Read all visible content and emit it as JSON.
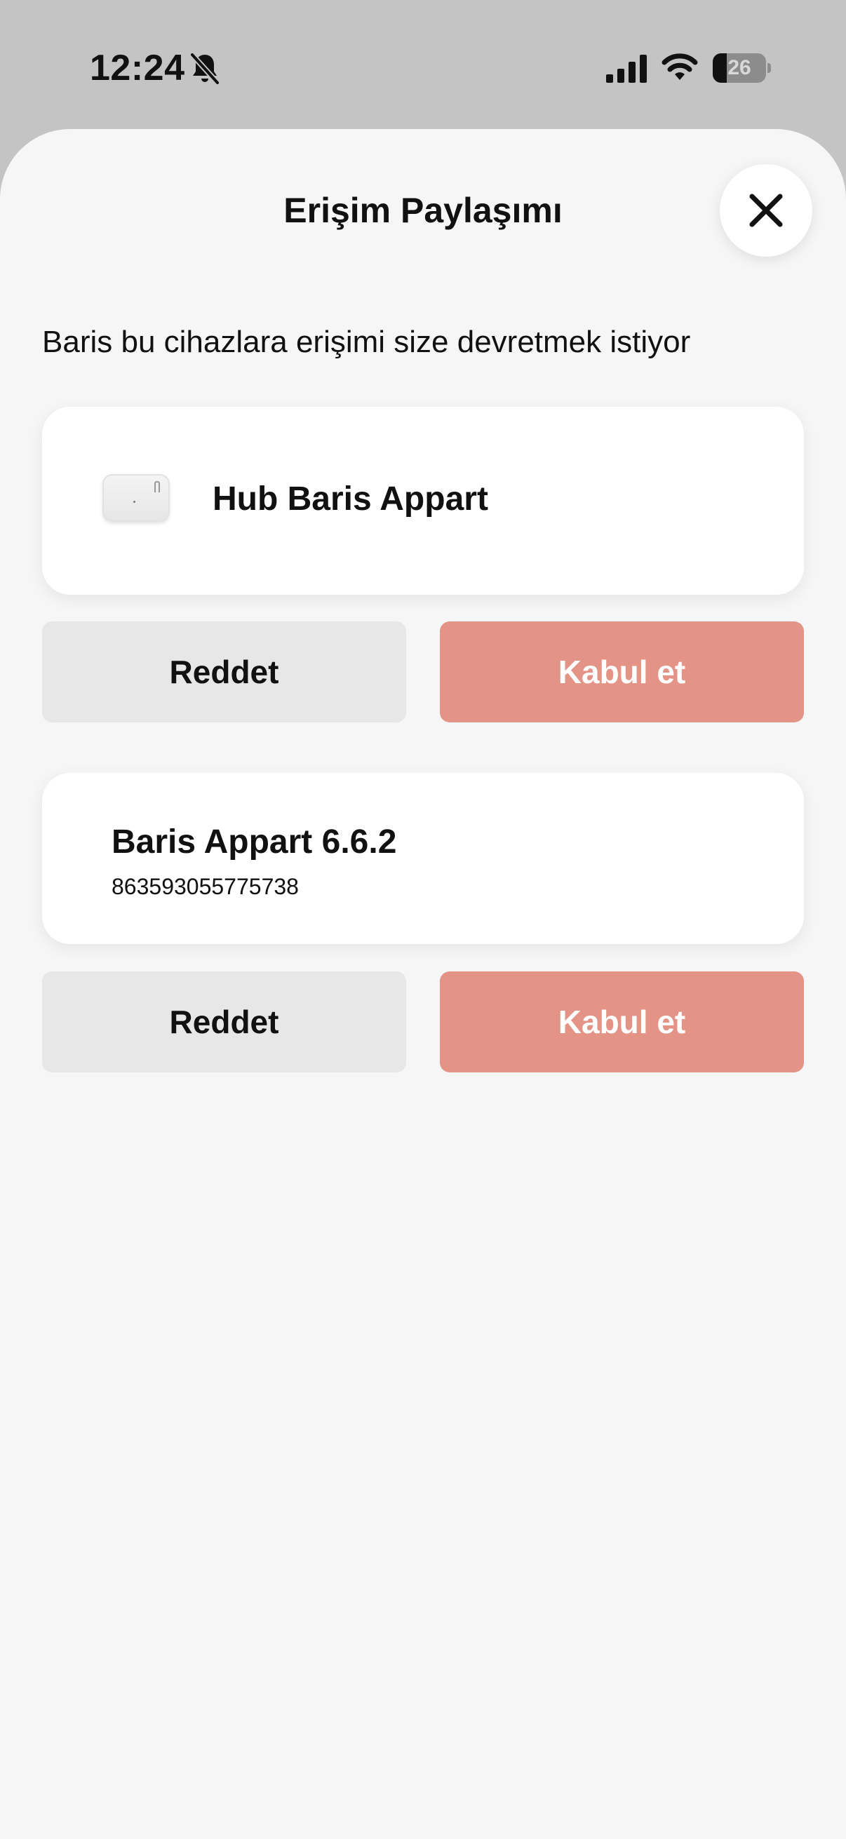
{
  "status_bar": {
    "time": "12:24",
    "battery_level": "26",
    "icons": [
      "bell-slash-icon",
      "cellular-signal-icon",
      "wifi-icon",
      "battery-icon"
    ]
  },
  "sheet": {
    "title": "Erişim Paylaşımı",
    "close_icon": "close-icon",
    "subtitle": "Baris bu cihazlara erişimi size devretmek istiyor"
  },
  "requests": [
    {
      "device_name": "Hub Baris Appart",
      "device_image": "hub-device-image",
      "reject_label": "Reddet",
      "accept_label": "Kabul et"
    },
    {
      "device_name": "Baris Appart 6.6.2",
      "device_serial": "863593055775738",
      "reject_label": "Reddet",
      "accept_label": "Kabul et"
    }
  ],
  "colors": {
    "accent": "#e39486",
    "reject_bg": "#e7e7e7",
    "sheet_bg": "#f6f6f6",
    "backdrop": "#c4c4c4"
  }
}
